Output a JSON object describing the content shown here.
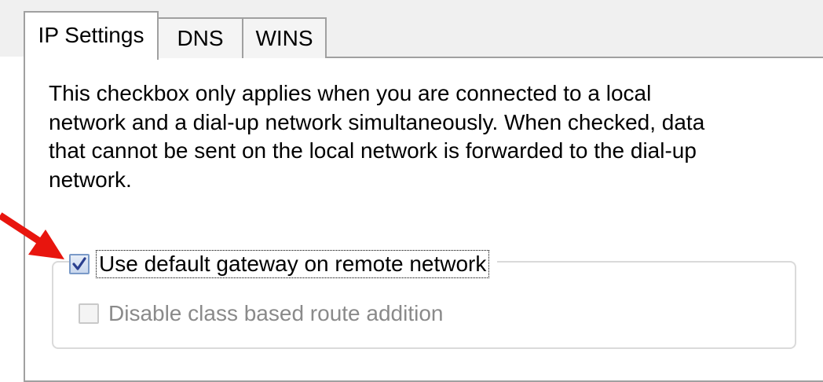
{
  "tabs": [
    {
      "label": "IP Settings",
      "active": true
    },
    {
      "label": "DNS",
      "active": false
    },
    {
      "label": "WINS",
      "active": false
    }
  ],
  "description": {
    "lines": [
      "This checkbox only applies when you are connected to a local",
      "network and a dial-up network simultaneously.  When checked, data",
      "that cannot be sent on the local network is forwarded to the dial-up",
      "network."
    ]
  },
  "options": {
    "default_gateway": {
      "label": "Use default gateway on remote network",
      "checked": true,
      "enabled": true
    },
    "class_based_route": {
      "label": "Disable class based route addition",
      "checked": false,
      "enabled": false
    }
  },
  "annotation": {
    "icon": "red-arrow-icon",
    "color": "#e8150e"
  }
}
